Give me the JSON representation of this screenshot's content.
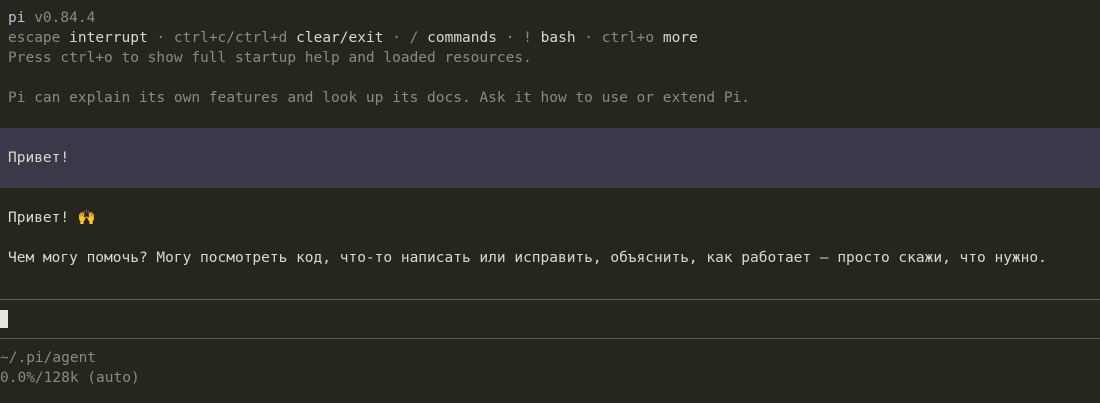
{
  "header": {
    "app_name": "pi",
    "version": "v0.84.4",
    "hints": [
      {
        "key": "escape",
        "action": "interrupt"
      },
      {
        "key": "ctrl+c/ctrl+d",
        "action": "clear/exit"
      },
      {
        "key": "/",
        "action": "commands"
      },
      {
        "key": "!",
        "action": "bash"
      },
      {
        "key": "ctrl+o",
        "action": "more"
      }
    ],
    "separator": " · ",
    "startup_note": "Press ctrl+o to show full startup help and loaded resources.",
    "intro": "Pi can explain its own features and look up its docs. Ask it how to use or extend Pi."
  },
  "conversation": {
    "user_message": "Привет!",
    "assistant_greeting": "Привет! 🙌",
    "assistant_body": "Чем могу помочь? Могу посмотреть код, что-то написать или исправить, объяснить, как работает — просто скажи, что нужно."
  },
  "footer": {
    "cwd": "~/.pi/agent",
    "context_usage": "0.0%/128k (auto)"
  },
  "colors": {
    "background": "#26261f",
    "user_block": "#393949",
    "dim_text": "#8a8a80",
    "bright_text": "#d8d8cc"
  }
}
